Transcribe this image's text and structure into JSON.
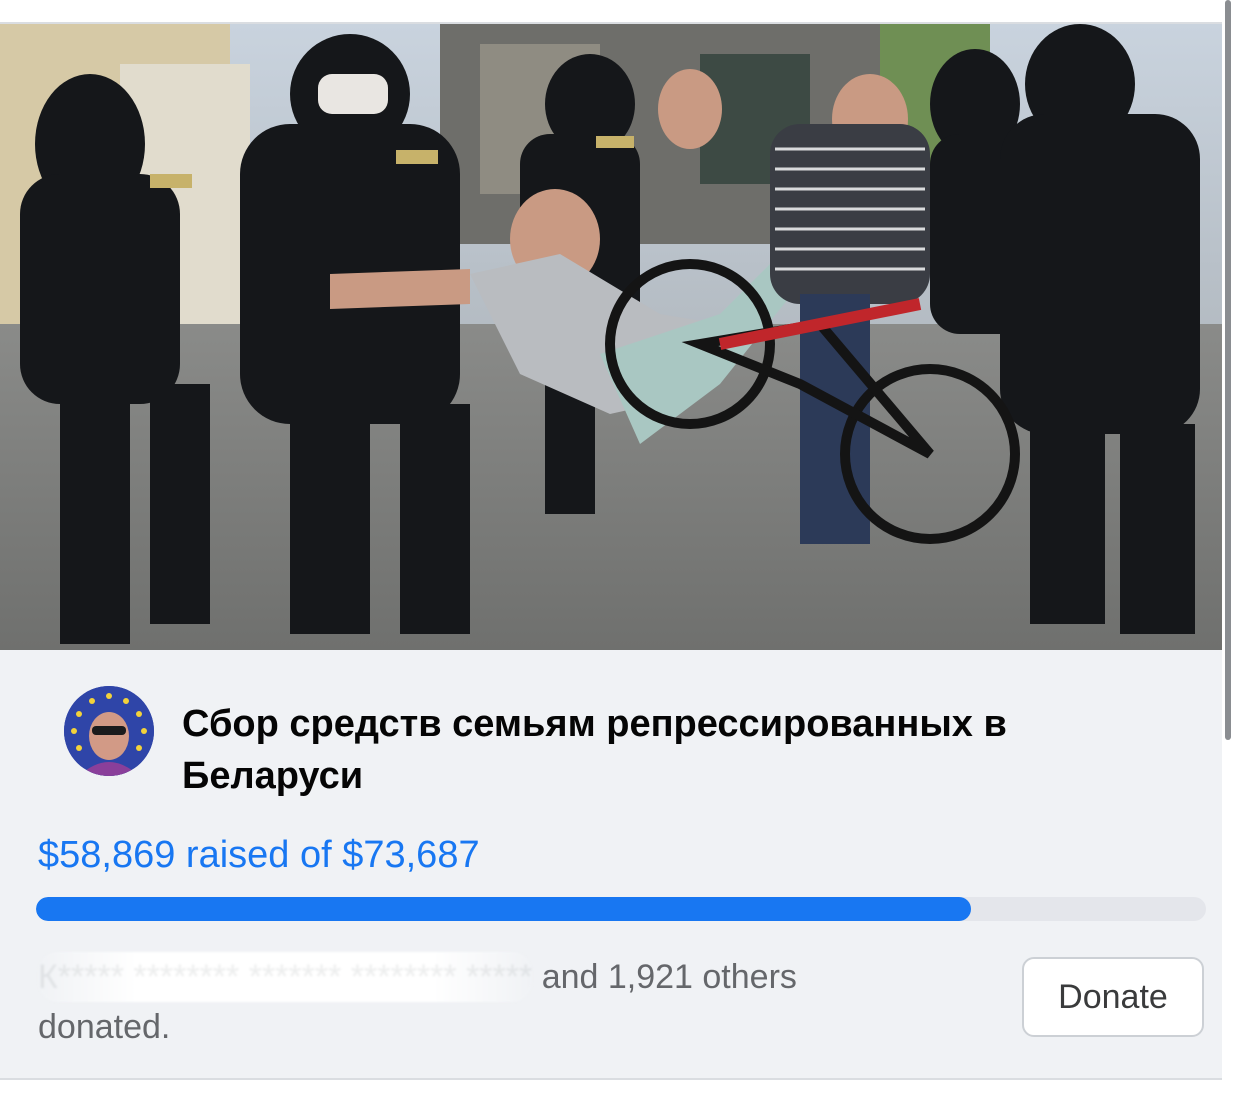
{
  "fundraiser": {
    "title": "Сбор средств семьям репрессированных в Беларуси",
    "raised_text": "$58,869 raised of $73,687",
    "raised_amount": 58869,
    "goal_amount": 73687,
    "progress_fraction": 0.799,
    "donors_redacted": "К***** ******** ******* ******** *****",
    "donors_visible": "and 1,921 others donated.",
    "donate_label": "Donate"
  },
  "colors": {
    "accent": "#1877f2",
    "card_bg": "#f0f2f5",
    "track": "#e4e6eb"
  },
  "icons": {
    "cover": "cover-photo",
    "avatar": "profile-avatar"
  }
}
